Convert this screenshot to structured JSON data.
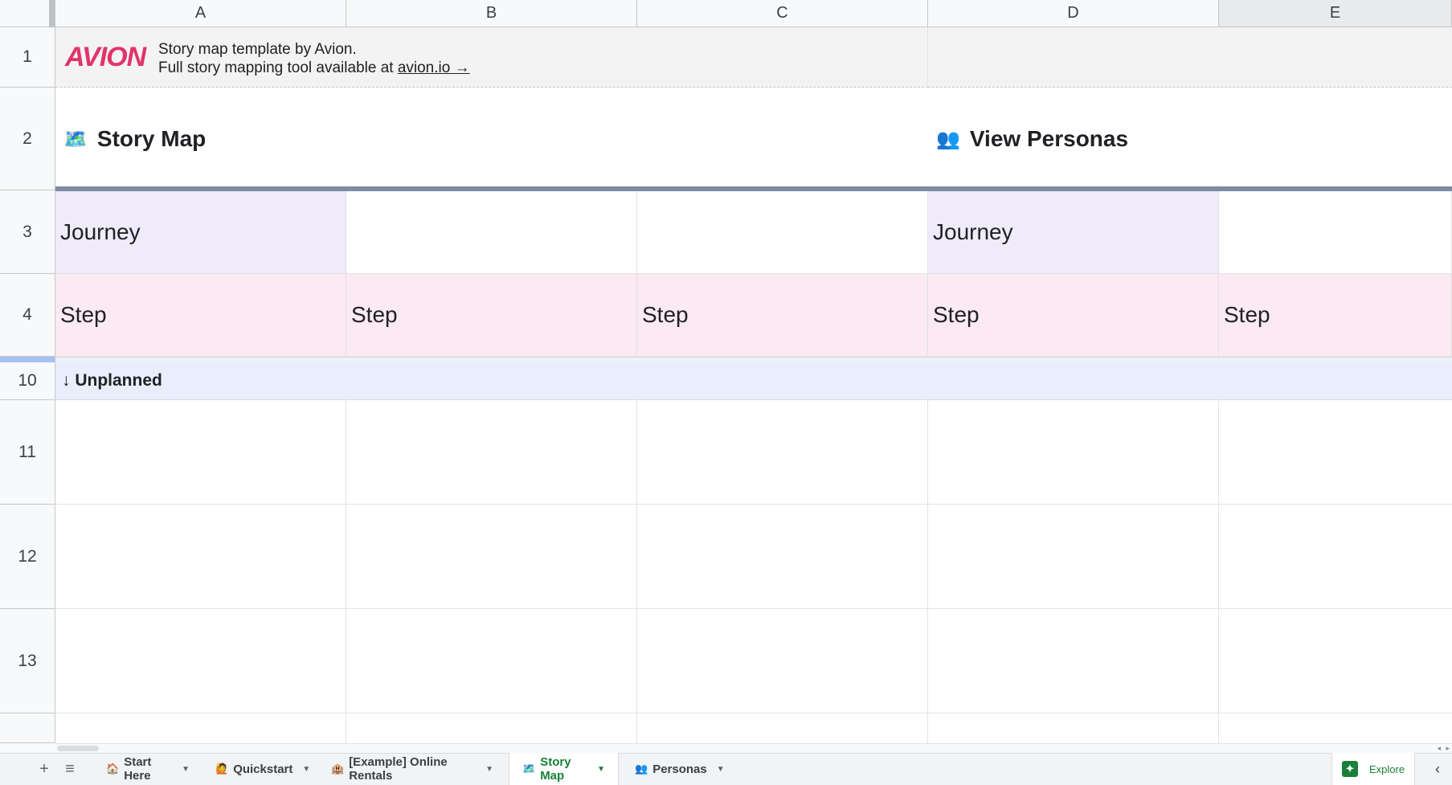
{
  "columns": [
    "A",
    "B",
    "C",
    "D",
    "E"
  ],
  "rows": [
    "1",
    "2",
    "3",
    "4",
    "10",
    "11",
    "12",
    "13"
  ],
  "banner": {
    "logo_text": "AVION",
    "line1": "Story map template by Avion.",
    "line2_prefix": "Full story mapping tool available at ",
    "link_text": "avion.io →"
  },
  "headings": {
    "story_map_icon": "🗺️",
    "story_map": "Story Map",
    "personas_icon": "👥",
    "view_personas": "View Personas"
  },
  "journey_row": [
    "Journey",
    "",
    "",
    "Journey",
    ""
  ],
  "step_row": [
    "Step",
    "Step",
    "Step",
    "Step",
    "Step"
  ],
  "unplanned_label": "↓ Unplanned",
  "tabs": [
    {
      "icon": "🏠",
      "label": "Start Here"
    },
    {
      "icon": "🙋",
      "label": "Quickstart"
    },
    {
      "icon": "🏨",
      "label": "[Example] Online Rentals"
    },
    {
      "icon": "🗺️",
      "label": "Story Map"
    },
    {
      "icon": "👥",
      "label": "Personas"
    }
  ],
  "explore_label": "Explore",
  "add_sheet_symbol": "+",
  "sheet_list_symbol": "≡",
  "colors": {
    "journey_fill": "#efebfb",
    "step_fill": "#fbeaf2",
    "unplanned_fill": "#e8eefc",
    "banner_fill": "#f3f3f3",
    "avion_pink": "#e2336b",
    "divider": "#7f8aa3",
    "active_tab_text": "#188038"
  }
}
